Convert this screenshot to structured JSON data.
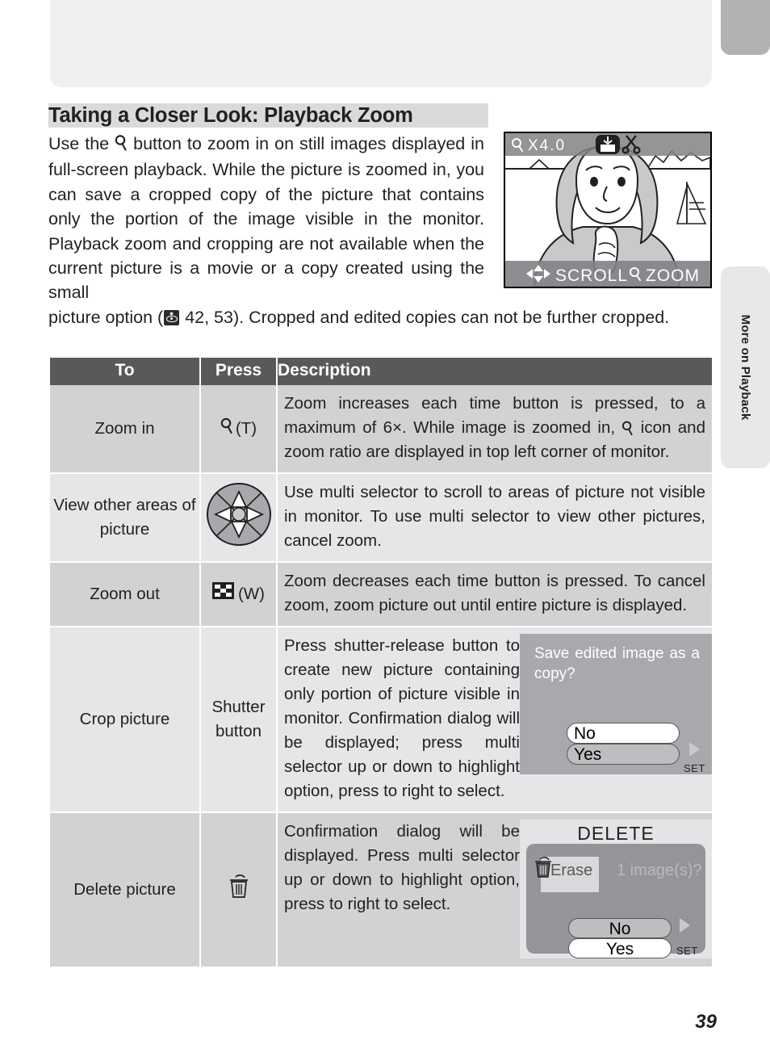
{
  "chapter_tab": {
    "label": "More on Playback"
  },
  "page": {
    "number": "39"
  },
  "heading": {
    "title": "Taking a Closer Look: Playback Zoom"
  },
  "intro": {
    "part1_a": "Use the ",
    "part1_icon": "magnifier-icon",
    "part1_b": " button to zoom in on still images displayed in full-screen playback.  While the picture is zoomed in, you can save a cropped copy of the picture that contains only the portion of the image visible in the monitor.  Playback zoom and cropping are not available when the current picture is a movie or a copy created using the small",
    "part2_a": "picture option (",
    "part2_icon": "see-also-eye-icon",
    "part2_b": " 42, 53).  Cropped and edited copies can not be further cropped."
  },
  "lcd": {
    "zoom_ratio": "X4.0",
    "zoom_icon": "magnifier-icon",
    "print_icon": "print-order-icon",
    "crop_icon": "scissors-icon",
    "hint_scroll": "SCROLL",
    "hint_zoom": "ZOOM",
    "hint_zoom_icon": "magnifier-icon",
    "multi_selector_icon": "four-way-arrows-icon"
  },
  "table": {
    "headers": {
      "to": "To",
      "press": "Press",
      "description": "Description"
    },
    "rows": [
      {
        "to": "Zoom in",
        "press_icon": "magnifier-icon",
        "press_label": "(T)",
        "description": "Zoom increases each time button is pressed, to a maximum of 6×.  While image is zoomed in, @ICON@ icon and zoom ratio are displayed in top left corner of monitor.",
        "desc_before": "Zoom increases each time button is pressed, to a maximum of 6×.  While image is zoomed in, ",
        "desc_after": " icon and zoom ratio are displayed in top left corner of monitor."
      },
      {
        "to": "View other areas of picture",
        "press_icon": "multi-selector-icon",
        "press_label": "",
        "description": "Use multi selector to scroll to areas of picture not visible in monitor.  To use multi selector to view other pictures, cancel zoom."
      },
      {
        "to": "Zoom out",
        "press_icon": "thumbnail-checkerboard-icon",
        "press_label": "(W)",
        "description": "Zoom decreases each time button is pressed.  To cancel zoom, zoom picture out until entire picture is displayed."
      },
      {
        "to": "Crop picture",
        "press_icon": "",
        "press_label": "Shutter button",
        "description": "Press shutter-release button to create new picture containing only portion of picture visible in monitor. Confirmation dialog will be displayed; press multi selector up or down to highlight option, press to right to select."
      },
      {
        "to": "Delete picture",
        "press_icon": "trash-can-icon",
        "press_label": "",
        "description": "Confirmation dialog will be displayed.  Press multi selector up or down to highlight option, press to right to select."
      }
    ]
  },
  "save_dialog": {
    "message": "Save edited image as a copy?",
    "option_no": "No",
    "option_yes": "Yes",
    "set_label": "SET",
    "arrow_icon": "right-triangle-icon",
    "selected": "No"
  },
  "delete_dialog": {
    "title": "DELETE",
    "trash_icon": "trash-can-icon",
    "erase_label": "Erase",
    "count_label": "1 image(s)?",
    "option_no": "No",
    "option_yes": "Yes",
    "set_label": "SET",
    "arrow_icon": "right-triangle-icon",
    "selected": "Yes"
  },
  "colors": {
    "header_band": "#58595b",
    "row_dark": "#d1d2d4",
    "row_light": "#e5e6e8",
    "title_band": "#d9dadb",
    "tab_dark": "#b0b2b4",
    "tab_light": "#e7e8ea",
    "lcd_gray": "#a7a9ac"
  }
}
